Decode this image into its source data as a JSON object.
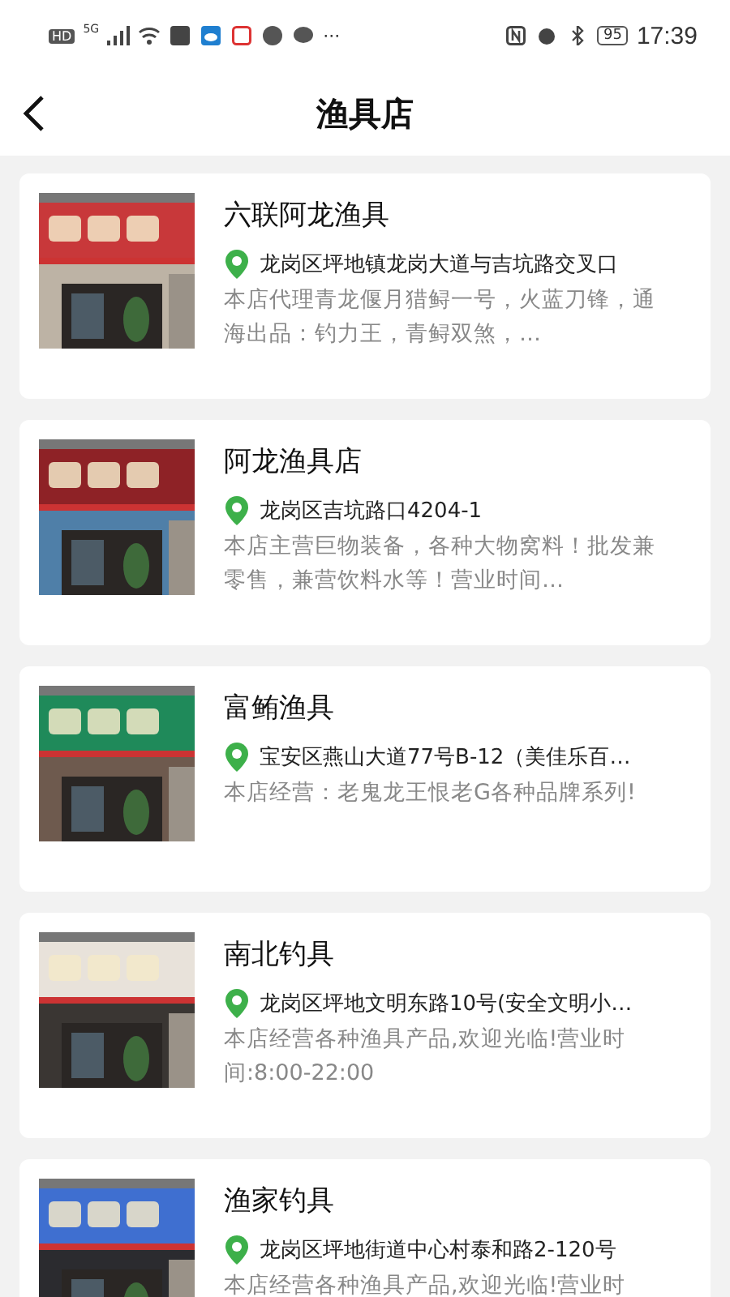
{
  "status_bar": {
    "left_texts": [
      "HD",
      "5G"
    ],
    "overflow": "···",
    "battery": "95",
    "time": "17:39"
  },
  "header": {
    "title": "渔具店"
  },
  "shops": [
    {
      "name": "六联阿龙渔具",
      "address": "龙岗区坪地镇龙岗大道与吉坑路交叉口",
      "description": "本店代理青龙偃月猎鲟一号，火蓝刀锋，通海出品：钓力王，青鲟双煞，…"
    },
    {
      "name": "阿龙渔具店",
      "address": "龙岗区吉坑路口4204-1",
      "description": "本店主营巨物装备，各种大物窝料！批发兼零售，兼营饮料水等！营业时间…"
    },
    {
      "name": "富鲔渔具",
      "address": "宝安区燕山大道77号B-12（美佳乐百…",
      "description": "本店经营：老鬼龙王恨老G各种品牌系列!"
    },
    {
      "name": "南北钓具",
      "address": "龙岗区坪地文明东路10号(安全文明小…",
      "description": "本店经营各种渔具产品,欢迎光临!营业时间:8:00-22:00"
    },
    {
      "name": "渔家钓具",
      "address": "龙岗区坪地街道中心村泰和路2-120号",
      "description": "本店经营各种渔具产品,欢迎光临!营业时"
    }
  ]
}
